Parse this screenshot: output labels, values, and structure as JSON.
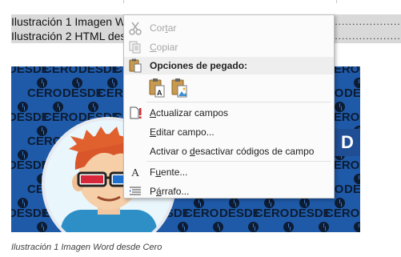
{
  "document": {
    "toc_lines": [
      {
        "text": "Ilustración 1 Imagen Word desde Cero",
        "dots": "................................................................................................................................................................"
      },
      {
        "text": "Ilustración 2 HTML desde Cero",
        "dots": "................................................................................................................................................................"
      }
    ],
    "banner": {
      "pattern_text": [
        "DESDE",
        "CERO"
      ],
      "corner_letter": "D",
      "colors": {
        "background": "#1f5aa8",
        "text": "#0c1c33"
      }
    },
    "caption": "Ilustración 1 Imagen Word desde Cero"
  },
  "context_menu": {
    "items": [
      {
        "id": "cut",
        "label": "Cortar",
        "underline": "t",
        "icon": "scissors-icon",
        "enabled": false
      },
      {
        "id": "copy",
        "label": "Copiar",
        "underline": "C",
        "icon": "copy-icon",
        "enabled": false
      },
      {
        "id": "paste-options",
        "label": "Opciones de pegado:",
        "icon": "clipboard-paste-icon",
        "enabled": true
      },
      {
        "id": "update-fields",
        "label": "Actualizar campos",
        "underline": "A",
        "icon": "update-fields-icon",
        "enabled": true
      },
      {
        "id": "edit-field",
        "label": "Editar campo...",
        "underline": "E",
        "icon": "",
        "enabled": true
      },
      {
        "id": "toggle-field-codes",
        "label": "Activar o desactivar códigos de campo",
        "underline": "d",
        "icon": "",
        "enabled": true
      },
      {
        "id": "font",
        "label": "Fuente...",
        "underline": "u",
        "icon": "font-icon",
        "enabled": true
      },
      {
        "id": "paragraph",
        "label": "Párrafo...",
        "underline": "á",
        "icon": "paragraph-icon",
        "enabled": true
      }
    ],
    "paste_buttons": [
      {
        "id": "paste-keep-text",
        "icon": "paste-keep-text-only-icon"
      },
      {
        "id": "paste-picture",
        "icon": "paste-as-picture-icon"
      }
    ]
  }
}
